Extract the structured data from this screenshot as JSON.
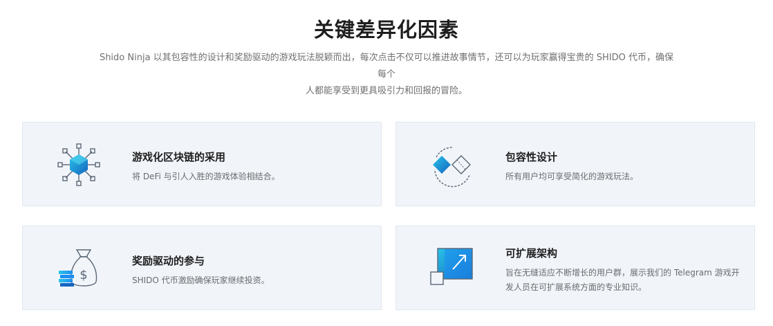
{
  "header": {
    "title": "关键差异化因素",
    "subtitle_line1": "Shido Ninja 以其包容性的设计和奖励驱动的游戏玩法脱颖而出，每次点击不仅可以推进故事情节，还可以为玩家赢得宝贵的 SHIDO 代币，确保每个",
    "subtitle_line2": "人都能享受到更具吸引力和回报的冒险。"
  },
  "cards": [
    {
      "title": "游戏化区块链的采用",
      "desc": "将 DeFi 与引人入胜的游戏体验相结合。",
      "icon": "blockchain-network-icon"
    },
    {
      "title": "包容性设计",
      "desc": "所有用户均可享受简化的游戏玩法。",
      "icon": "inclusive-diamond-icon"
    },
    {
      "title": "奖励驱动的参与",
      "desc": "SHIDO 代币激励确保玩家继续投资。",
      "icon": "money-bag-icon"
    },
    {
      "title": "可扩展架构",
      "desc": "旨在无缝适应不断增长的用户群，展示我们的 Telegram 游戏开发人员在可扩展系统方面的专业知识。",
      "icon": "scale-up-arrow-icon"
    }
  ],
  "colors": {
    "accent_blue": "#1c8ef0",
    "deep_blue": "#1565c0",
    "cyan": "#29c3e8",
    "card_bg": "#f1f5fa",
    "outline_gray": "#5a6573"
  }
}
